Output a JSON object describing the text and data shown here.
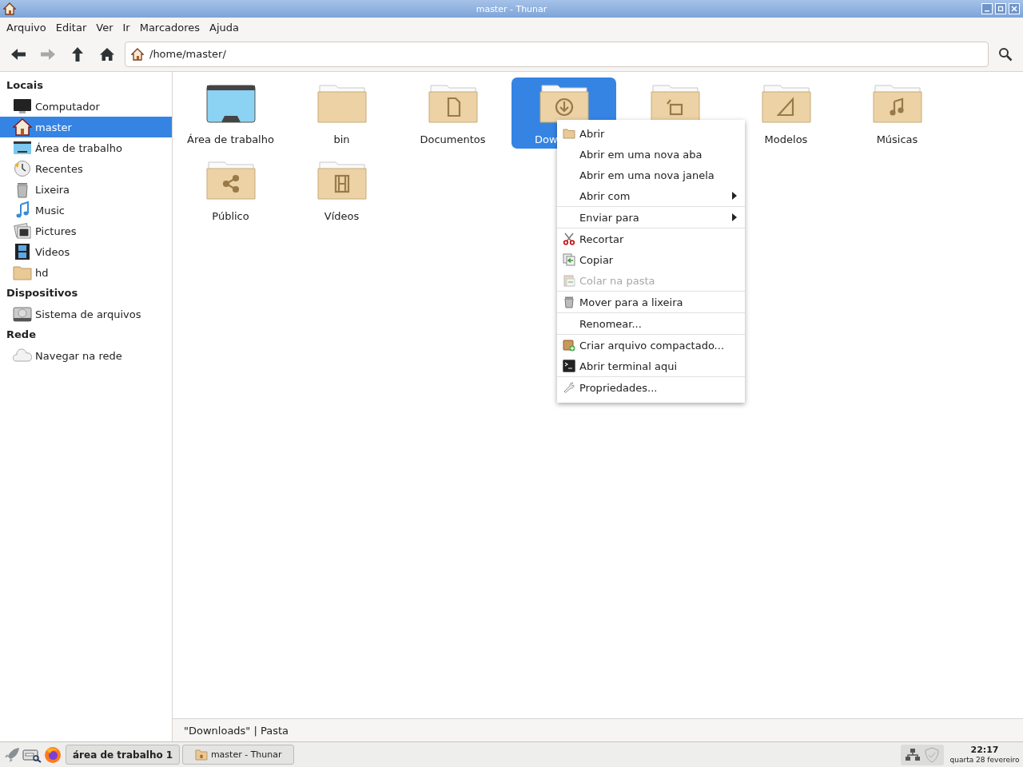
{
  "window": {
    "title": "master - Thunar"
  },
  "menubar": [
    "Arquivo",
    "Editar",
    "Ver",
    "Ir",
    "Marcadores",
    "Ajuda"
  ],
  "toolbar": {
    "back_enabled": true,
    "forward_enabled": false,
    "path": "/home/master/"
  },
  "sidebar": [
    {
      "heading": "Locais",
      "items": [
        {
          "label": "Computador",
          "kind": "computer",
          "selected": false
        },
        {
          "label": "master",
          "kind": "home",
          "selected": true
        },
        {
          "label": "Área de trabalho",
          "kind": "desktop",
          "selected": false
        },
        {
          "label": "Recentes",
          "kind": "recent",
          "selected": false
        },
        {
          "label": "Lixeira",
          "kind": "trash",
          "selected": false
        },
        {
          "label": "Music",
          "kind": "music",
          "selected": false
        },
        {
          "label": "Pictures",
          "kind": "pictures",
          "selected": false
        },
        {
          "label": "Videos",
          "kind": "video",
          "selected": false
        },
        {
          "label": "hd",
          "kind": "folder",
          "selected": false
        }
      ]
    },
    {
      "heading": "Dispositivos",
      "items": [
        {
          "label": "Sistema de arquivos",
          "kind": "drive",
          "selected": false
        }
      ]
    },
    {
      "heading": "Rede",
      "items": [
        {
          "label": "Navegar na rede",
          "kind": "network",
          "selected": false
        }
      ]
    }
  ],
  "files": [
    {
      "label": "Área de trabalho",
      "kind": "desktop",
      "selected": false
    },
    {
      "label": "bin",
      "kind": "plain",
      "selected": false
    },
    {
      "label": "Documentos",
      "kind": "document",
      "selected": false
    },
    {
      "label": "Dow",
      "kind": "download",
      "selected": true
    },
    {
      "kind": "picture",
      "selected": false
    },
    {
      "label": "Modelos",
      "kind": "template",
      "selected": false
    },
    {
      "label": "Músicas",
      "kind": "music",
      "selected": false
    },
    {
      "label": "Público",
      "kind": "share",
      "selected": false
    },
    {
      "label": "Vídeos",
      "kind": "video",
      "selected": false
    }
  ],
  "context_menu": [
    [
      {
        "label": "Abrir",
        "kind": "folder",
        "disabled": false,
        "submenu": false
      },
      {
        "label": "Abrir em uma nova aba",
        "disabled": false,
        "submenu": false
      },
      {
        "label": "Abrir em uma nova janela",
        "disabled": false,
        "submenu": false
      },
      {
        "label": "Abrir com",
        "disabled": false,
        "submenu": true
      }
    ],
    [
      {
        "label": "Enviar para",
        "disabled": false,
        "submenu": true
      }
    ],
    [
      {
        "label": "Recortar",
        "kind": "scissors",
        "disabled": false,
        "submenu": false
      },
      {
        "label": "Copiar",
        "kind": "copy",
        "disabled": false,
        "submenu": false
      },
      {
        "label": "Colar na pasta",
        "kind": "paste",
        "disabled": true,
        "submenu": false
      }
    ],
    [
      {
        "label": "Mover para a lixeira",
        "kind": "trash",
        "disabled": false,
        "submenu": false
      }
    ],
    [
      {
        "label": "Renomear...",
        "disabled": false,
        "submenu": false
      }
    ],
    [
      {
        "label": "Criar arquivo compactado...",
        "kind": "archive",
        "disabled": false,
        "submenu": false
      },
      {
        "label": "Abrir terminal aqui",
        "kind": "terminal",
        "disabled": false,
        "submenu": false
      }
    ],
    [
      {
        "label": "Propriedades...",
        "kind": "properties",
        "disabled": false,
        "submenu": false
      }
    ]
  ],
  "status_bar": {
    "text": "\"Downloads\" | Pasta"
  },
  "taskbar": {
    "workspace": "área de trabalho 1",
    "tasks": [
      {
        "label": "master - Thunar",
        "selected": false
      }
    ],
    "clock": {
      "time": "22:17",
      "date": "quarta 28 fevereiro"
    }
  }
}
